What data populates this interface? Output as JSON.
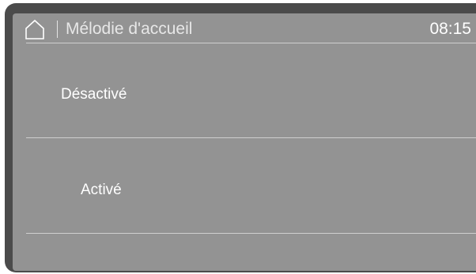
{
  "header": {
    "title": "Mélodie d'accueil",
    "time": "08:15",
    "home_icon": "home-icon"
  },
  "options": [
    {
      "label": "Désactivé"
    },
    {
      "label": "Activé"
    }
  ],
  "colors": {
    "bezel": "#4b4b4b",
    "screen": "#939393",
    "text": "#ffffff",
    "divider": "#cfcfcf"
  }
}
